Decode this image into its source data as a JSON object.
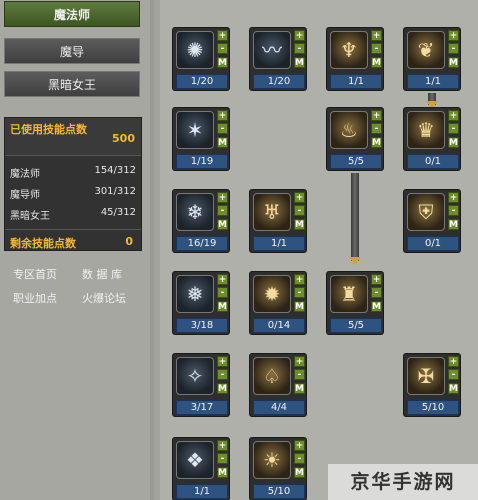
{
  "class_tabs": [
    "魔法师",
    "魔导",
    "黑暗女王"
  ],
  "points": {
    "used_label": "已使用技能点数",
    "used_value": "500",
    "class_rows": [
      {
        "name": "魔法师",
        "value": "154/312"
      },
      {
        "name": "魔导师",
        "value": "301/312"
      },
      {
        "name": "黑暗女王",
        "value": "45/312"
      }
    ],
    "remaining_label": "剩余技能点数",
    "remaining_value": "0"
  },
  "nav_links": [
    "专区首页",
    "数 据 库",
    "职业加点",
    "火爆论坛"
  ],
  "skill_buttons": {
    "plus": "+",
    "minus": "-",
    "master": "M"
  },
  "skills": [
    {
      "level": "1/20",
      "icon": "water-burst-icon",
      "glyph": "✺"
    },
    {
      "level": "1/20",
      "icon": "wave-icon",
      "glyph": "〰"
    },
    {
      "level": "1/1",
      "icon": "figure-icon",
      "glyph": "♆"
    },
    {
      "level": "1/1",
      "icon": "dove-icon",
      "glyph": "❦"
    },
    {
      "level": "1/19",
      "icon": "frost-star-icon",
      "glyph": "✶"
    },
    {
      "level": "5/5",
      "icon": "flame-figure-icon",
      "glyph": "♨"
    },
    {
      "level": "0/1",
      "icon": "warrior-icon",
      "glyph": "♛"
    },
    {
      "level": "16/19",
      "icon": "ice-shard-icon",
      "glyph": "❄"
    },
    {
      "level": "1/1",
      "icon": "bolt-figure-icon",
      "glyph": "♅"
    },
    {
      "level": "0/1",
      "icon": "shield-icon",
      "glyph": "⛨"
    },
    {
      "level": "3/18",
      "icon": "blizzard-icon",
      "glyph": "❅"
    },
    {
      "level": "0/14",
      "icon": "fire-orb-icon",
      "glyph": "✹"
    },
    {
      "level": "5/5",
      "icon": "golem-icon",
      "glyph": "♜"
    },
    {
      "level": "3/17",
      "icon": "storm-icon",
      "glyph": "✧"
    },
    {
      "level": "4/4",
      "icon": "dancer-icon",
      "glyph": "♤"
    },
    {
      "level": "5/10",
      "icon": "crest-icon",
      "glyph": "✠"
    },
    {
      "level": "1/1",
      "icon": "crystal-icon",
      "glyph": "❖"
    },
    {
      "level": "5/10",
      "icon": "sun-icon",
      "glyph": "☀"
    }
  ],
  "watermark": "京华手游网"
}
